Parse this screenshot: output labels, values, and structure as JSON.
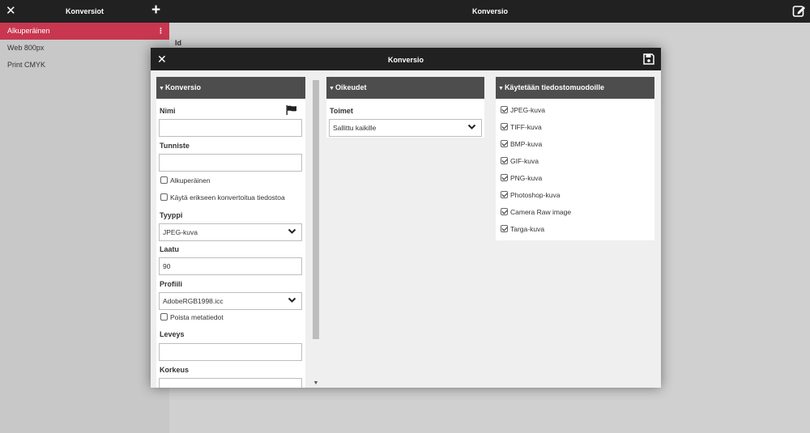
{
  "topbar": {
    "left_title": "Konversiot",
    "center_title": "Konversio",
    "close_icon": "close-icon",
    "add_icon": "plus-icon",
    "edit_icon": "edit-icon"
  },
  "sidebar": {
    "items": [
      {
        "label": "Alkuperäinen",
        "active": true
      },
      {
        "label": "Web 800px",
        "active": false
      },
      {
        "label": "Print CMYK",
        "active": false
      }
    ],
    "kebab": "⋮"
  },
  "background": {
    "id_label": "Id"
  },
  "modal": {
    "title": "Konversio",
    "close_icon": "close-icon",
    "save_icon": "save-icon"
  },
  "conversion_panel": {
    "title": "Konversio",
    "name_label": "Nimi",
    "name_value": "",
    "identifier_label": "Tunniste",
    "identifier_value": "",
    "original_checkbox": {
      "label": "Alkuperäinen",
      "checked": false
    },
    "separate_checkbox": {
      "label": "Käytä erikseen konvertoitua tiedostoa",
      "checked": false
    },
    "type_label": "Tyyppi",
    "type_value": "JPEG-kuva",
    "quality_label": "Laatu",
    "quality_value": "90",
    "profile_label": "Profiili",
    "profile_value": "AdobeRGB1998.icc",
    "remove_metadata_checkbox": {
      "label": "Poista metatiedot",
      "checked": false
    },
    "width_label": "Leveys",
    "width_value": "",
    "height_label": "Korkeus",
    "height_value": ""
  },
  "rights_panel": {
    "title": "Oikeudet",
    "actions_label": "Toimet",
    "actions_value": "Sallittu kaikille"
  },
  "formats_panel": {
    "title": "Käytetään tiedostomuodoille",
    "formats": [
      {
        "label": "JPEG-kuva",
        "checked": true
      },
      {
        "label": "TIFF-kuva",
        "checked": true
      },
      {
        "label": "BMP-kuva",
        "checked": true
      },
      {
        "label": "GIF-kuva",
        "checked": true
      },
      {
        "label": "PNG-kuva",
        "checked": true
      },
      {
        "label": "Photoshop-kuva",
        "checked": true
      },
      {
        "label": "Camera Raw image",
        "checked": true
      },
      {
        "label": "Targa-kuva",
        "checked": true
      }
    ]
  },
  "colors": {
    "topbar": "#212121",
    "active_item": "#c8374f",
    "panel_header": "#4d4d4d"
  }
}
